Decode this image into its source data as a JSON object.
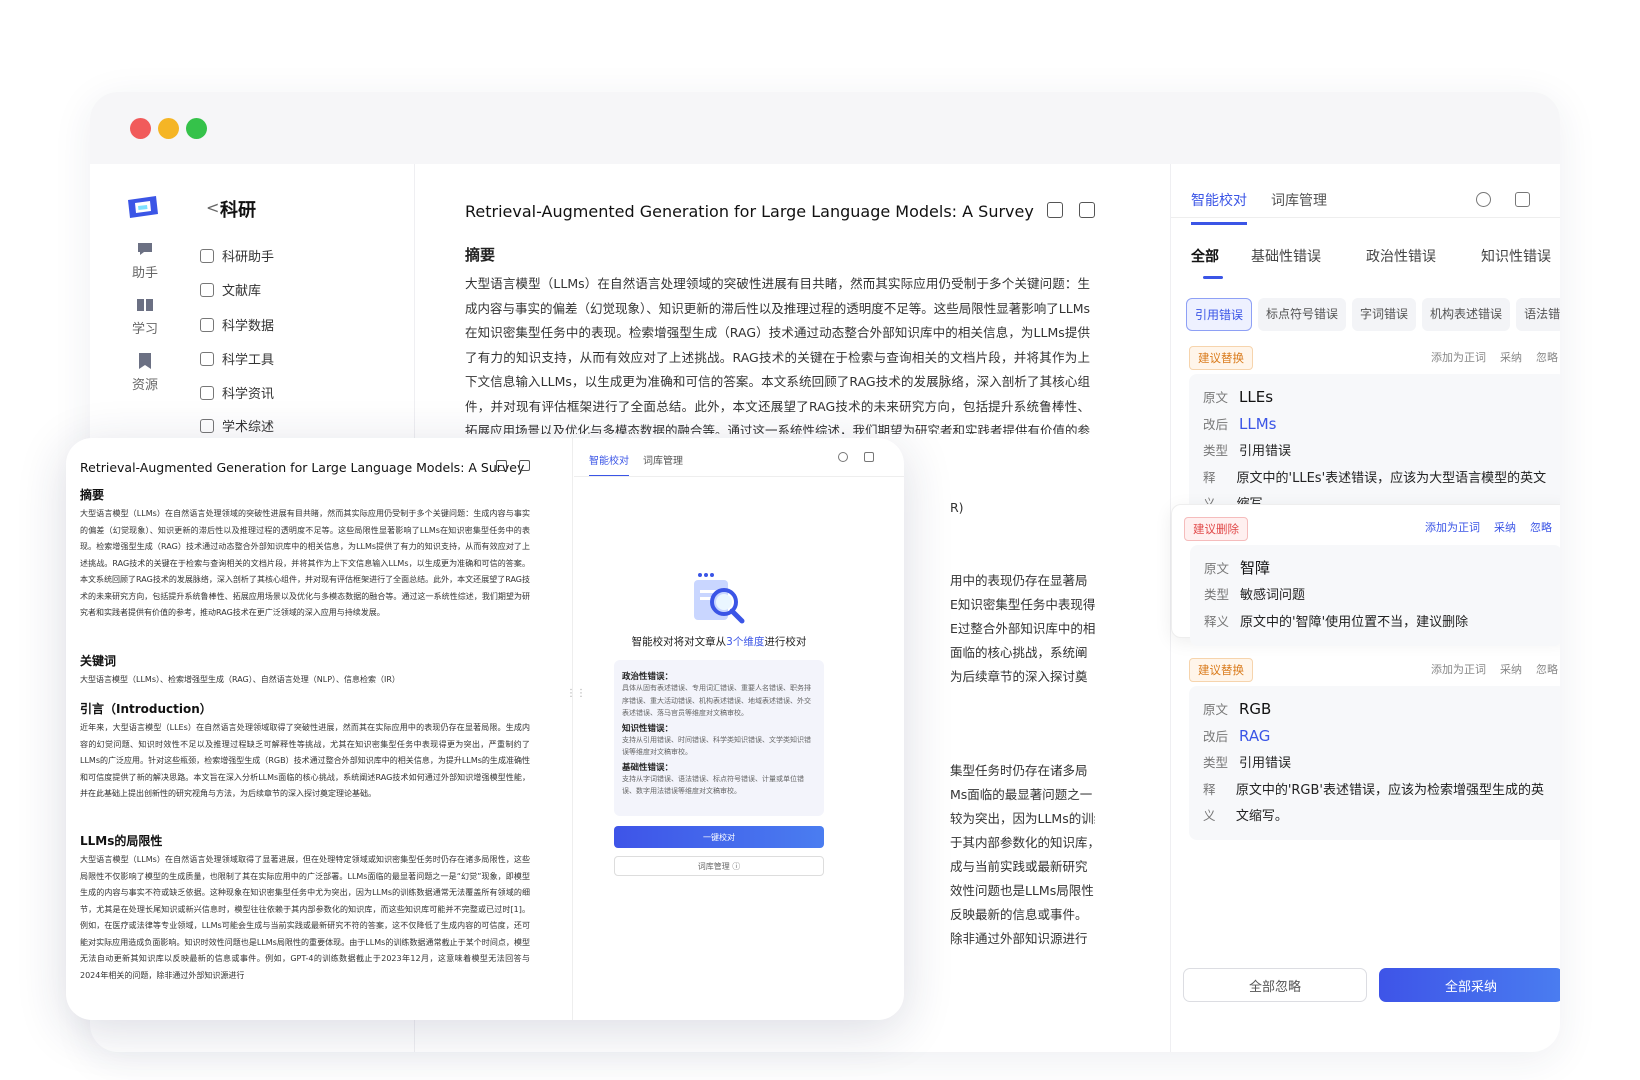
{
  "rail": {
    "items": [
      {
        "label": "助手",
        "icon": "chat-icon"
      },
      {
        "label": "学习",
        "icon": "book-icon"
      },
      {
        "label": "资源",
        "icon": "bookmark-icon"
      }
    ],
    "active_icon": "flask-icon"
  },
  "sidebar": {
    "title": "科研",
    "back": "<",
    "items": [
      "科研助手",
      "文献库",
      "科学数据",
      "科学工具",
      "科学资讯",
      "学术综述"
    ]
  },
  "doc": {
    "title": "Retrieval-Augmented Generation for Large Language Models: A Survey",
    "abstract_heading": "摘要",
    "abstract": "大型语言模型（LLMs）在自然语言处理领域的突破性进展有目共睹，然而其实际应用仍受制于多个关键问题：生成内容与事实的偏差（幻觉现象）、知识更新的滞后性以及推理过程的透明度不足等。这些局限性显著影响了LLMs在知识密集型任务中的表现。检索增强型生成（RAG）技术通过动态整合外部知识库中的相关信息，为LLMs提供了有力的知识支持，从而有效应对了上述挑战。RAG技术的关键在于检索与查询相关的文档片段，并将其作为上下文信息输入LLMs，以生成更为准确和可信的答案。本文系统回顾了RAG技术的发展脉络，深入剖析了其核心组件，并对现有评估框架进行了全面总结。此外，本文还展望了RAG技术的未来研究方向，包括提升系统鲁棒性、拓展应用场景以及优化与多模态数据的融合等。通过这一系统性综述，我们期望为研究者和实践者提供有价值的参考，推动RAG技术",
    "fragments": [
      "R)",
      "用中的表现仍存在显著局",
      "E知识密集型任务中表现得",
      "E过整合外部知识库中的相",
      "面临的核心挑战，系统阐",
      "为后续章节的深入探讨奠",
      "集型任务时仍存在诸多局",
      "Ms面临的最显著问题之一",
      "较为突出，因为LLMs的训练",
      "于其内部参数化的知识库，",
      "成与当前实践或最新研究",
      "效性问题也是LLMs局限性",
      "反映最新的信息或事件。",
      "除非通过外部知识源进行"
    ]
  },
  "panel": {
    "tabs": [
      "智能校对",
      "词库管理"
    ],
    "categories": [
      "全部",
      "基础性错误",
      "政治性错误",
      "知识性错误"
    ],
    "chips": [
      "引用错误",
      "标点符号错误",
      "字词错误",
      "机构表述错误",
      "语法错误"
    ],
    "actions": [
      "添加为正词",
      "采纳",
      "忽略"
    ],
    "labels": {
      "original": "原文",
      "revised": "改后",
      "type": "类型",
      "explain": "释义"
    },
    "cards": [
      {
        "tag": "建议替换",
        "original": "LLEs",
        "revised": "LLMs",
        "type": "引用错误",
        "explain": "原文中的'LLEs'表述错误，应该为大型语言模型的英文缩写。"
      },
      {
        "tag": "建议删除",
        "original": "智障",
        "type": "敏感词问题",
        "explain": "原文中的'智障'使用位置不当，建议删除"
      },
      {
        "tag": "建议替换",
        "original": "RGB",
        "revised": "RAG",
        "type": "引用错误",
        "explain": "原文中的'RGB'表述错误，应该为检索增强型生成的英文缩写。"
      }
    ],
    "ignore_all": "全部忽略",
    "accept_all": "全部采纳"
  },
  "overlay": {
    "title": "Retrieval-Augmented Generation for Large Language Models: A Survey",
    "abstract_heading": "摘要",
    "abstract": "大型语言模型（LLMs）在自然语言处理领域的突破性进展有目共睹，然而其实际应用仍受制于多个关键问题：生成内容与事实的偏差（幻觉现象）、知识更新的滞后性以及推理过程的透明度不足等。这些局限性显著影响了LLMs在知识密集型任务中的表现。检索增强型生成（RAG）技术通过动态整合外部知识库中的相关信息，为LLMs提供了有力的知识支持，从而有效应对了上述挑战。RAG技术的关键在于检索与查询相关的文档片段，并将其作为上下文信息输入LLMs，以生成更为准确和可信的答案。本文系统回顾了RAG技术的发展脉络，深入剖析了其核心组件，并对现有评估框架进行了全面总结。此外，本文还展望了RAG技术的未来研究方向，包括提升系统鲁棒性、拓展应用场景以及优化与多模态数据的融合等。通过这一系统性综述，我们期望为研究者和实践者提供有价值的参考，推动RAG技术在更广泛领域的深入应用与持续发展。",
    "keywords_heading": "关键词",
    "keywords": "大型语言模型（LLMs）、检索增强型生成（RAG）、自然语言处理（NLP）、信息检索（IR）",
    "intro_heading": "引言（Introduction）",
    "intro": "近年来，大型语言模型（LLEs）在自然语言处理领域取得了突破性进展，然而其在实际应用中的表现仍存在显著局限。生成内容的幻觉问题、知识时效性不足以及推理过程缺乏可解释性等挑战，尤其在知识密集型任务中表现得更为突出，严重制约了LLMs的广泛应用。针对这些瓶颈，检索增强型生成（RGB）技术通过整合外部知识库中的相关信息，为提升LLMs的生成准确性和可信度提供了新的解决思路。本文旨在深入分析LLMs面临的核心挑战，系统阐述RAG技术如何通过外部知识增强模型性能，并在此基础上提出创新性的研究视角与方法，为后续章节的深入探讨奠定理论基础。",
    "limits_heading": "LLMs的局限性",
    "limits": "大型语言模型（LLMs）在自然语言处理领域取得了显著进展，但在处理特定领域或知识密集型任务时仍存在诸多局限性，这些局限性不仅影响了模型的生成质量，也限制了其在实际应用中的广泛部署。LLMs面临的最显著问题之一是“幻觉”现象，即模型生成的内容与事实不符或缺乏依据。这种现象在知识密集型任务中尤为突出，因为LLMs的训练数据通常无法覆盖所有领域的细节，尤其是在处理长尾知识或新兴信息时，模型往往依赖于其内部参数化的知识库，而这些知识库可能并不完整或已过时[1]。例如，在医疗或法律等专业领域，LLMs可能会生成与当前实践或最新研究不符的答案，这不仅降低了生成内容的可信度，还可能对实际应用造成负面影响。知识时效性问题也是LLMs局限性的重要体现。由于LLMs的训练数据通常截止于某个时间点，模型无法自动更新其知识库以反映最新的信息或事件。例如，GPT-4的训练数据截止于2023年12月，这意味着模型无法回答与2024年相关的问题，除非通过外部知识源进行",
    "tabs": [
      "智能校对",
      "词库管理"
    ],
    "intro_text_prefix": "智能校对将对文章从",
    "intro_text_highlight": "3个维度",
    "intro_text_suffix": "进行校对",
    "box": [
      {
        "h": "政治性错误：",
        "t": "具体从固有表述错误、专用词汇错误、重要人名错误、职务排序错误、重大活动错误、机构表述错误、地域表述错误、外交表述错误、落马官员等维度对文稿审校。"
      },
      {
        "h": "知识性错误：",
        "t": "支持从引用错误、时间错误、科学类知识错误、文学类知识错误等维度对文稿审校。"
      },
      {
        "h": "基础性错误：",
        "t": "支持从字词错误、语法错误、标点符号错误、计量或单位错误、数字用法错误等维度对文稿审校。"
      }
    ],
    "primary_btn": "一键校对",
    "secondary_btn": "词库管理 ⓘ"
  }
}
